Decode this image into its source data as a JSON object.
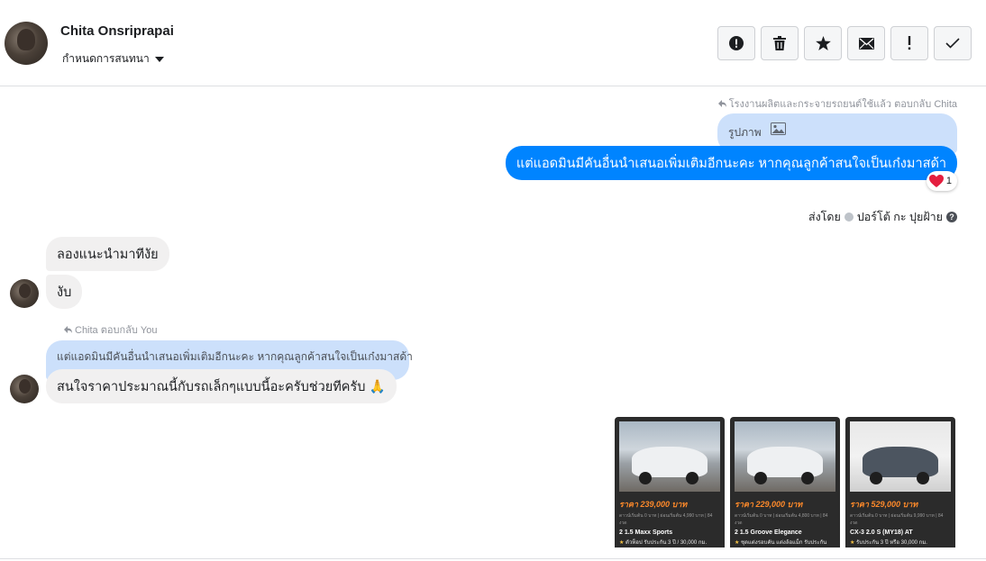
{
  "header": {
    "contact_name": "Chita Onsriprapai",
    "assign_label": "กำหนดการสนทนา",
    "toolbar": [
      {
        "name": "report-spam-button",
        "icon": "exclamation-circle-icon"
      },
      {
        "name": "delete-button",
        "icon": "trash-icon"
      },
      {
        "name": "star-button",
        "icon": "star-icon"
      },
      {
        "name": "mark-unread-button",
        "icon": "envelope-icon"
      },
      {
        "name": "follow-up-button",
        "icon": "exclamation-icon"
      },
      {
        "name": "mark-done-button",
        "icon": "check-icon"
      }
    ]
  },
  "conversation": {
    "reply_context_outgoing": "โรงงานผลิตและกระจายรถยนต์ใช้แล้ว ตอบกลับ Chita",
    "quoted_outgoing_label": "รูปภาพ",
    "outgoing_message": "แต่แอดมินมีคันอื่นนำเสนอเพิ่มเติมอีกนะคะ หากคุณลูกค้าสนใจเป็นเก๋งมาสด้า",
    "reaction_count": "1",
    "sent_by_prefix": "ส่งโดย",
    "sent_by_name": "ปอร์โต้ กะ ปุยฝ้าย",
    "incoming_1": "ลองแนะนำมาทีงัย",
    "incoming_2": "งับ",
    "reply_context_incoming": "Chita ตอบกลับ You",
    "quoted_incoming": "แต่แอดมินมีคันอื่นนำเสนอเพิ่มเติมอีกนะคะ หากคุณลูกค้าสนใจเป็นเก๋งมาสด้า",
    "incoming_3": "สนใจราคาประมาณนี้กับรถเล็กๆแบบนี้อะครับช่วยทีครับ 🙏"
  },
  "cards": [
    {
      "price": "ราคา 239,000 บาท",
      "small": "ดาวน์เริ่มต้น 0 บาท | ผ่อนเริ่มต้น 4,990 บาท | 84 งวด",
      "model": "2 1.5 Maxx Sports",
      "warranty": "ตัวท็อป รับประกัน 3 ปี / 30,000 กม.",
      "car_color": "light"
    },
    {
      "price": "ราคา 229,000 บาท",
      "small": "ดาวน์เริ่มต้น 0 บาท | ผ่อนเริ่มต้น 4,800 บาท | 84 งวด",
      "model": "2 1.5 Groove Elegance",
      "warranty": "ชุดแต่งรอบคัน แต่งล้อแม็ก รับประกัน",
      "car_color": "light"
    },
    {
      "price": "ราคา 529,000 บาท",
      "small": "ดาวน์เริ่มต้น 0 บาท | ผ่อนเริ่มต้น 9,990 บาท | 84 งวด",
      "model": "CX-3 2.0 S (MY18) AT",
      "warranty": "รับประกัน 3 ปี หรือ 30,000 กม.",
      "car_color": "dark"
    }
  ],
  "colors": {
    "outgoing_bubble": "#0084ff",
    "incoming_bubble": "#f1f0f0",
    "quoted_bubble": "#cce0fb",
    "reaction_heart": "#e41e3f"
  }
}
